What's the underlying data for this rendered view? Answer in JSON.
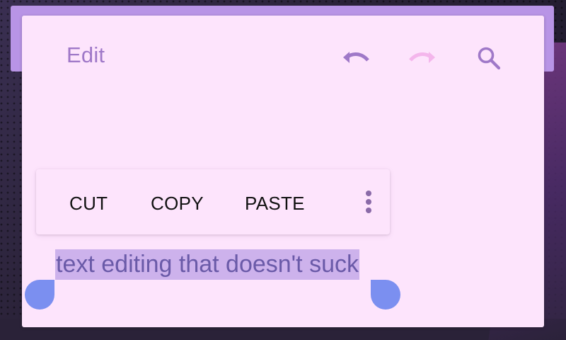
{
  "header": {
    "title": "Edit",
    "icons": [
      "undo-icon",
      "redo-icon",
      "search-icon"
    ],
    "redo_enabled": false
  },
  "context_menu": {
    "cut_label": "CUT",
    "copy_label": "COPY",
    "paste_label": "PASTE",
    "more_icon": "more-vert-icon"
  },
  "editor": {
    "selected_text": "text editing that doesn't suck"
  },
  "colors": {
    "app_bar": "#b894e6",
    "card": "#fde4fc",
    "accent": "#9f78c8",
    "selection": "#cdb2ec",
    "handle": "#7b8ff0",
    "disabled_icon": "#f4b6ec"
  }
}
